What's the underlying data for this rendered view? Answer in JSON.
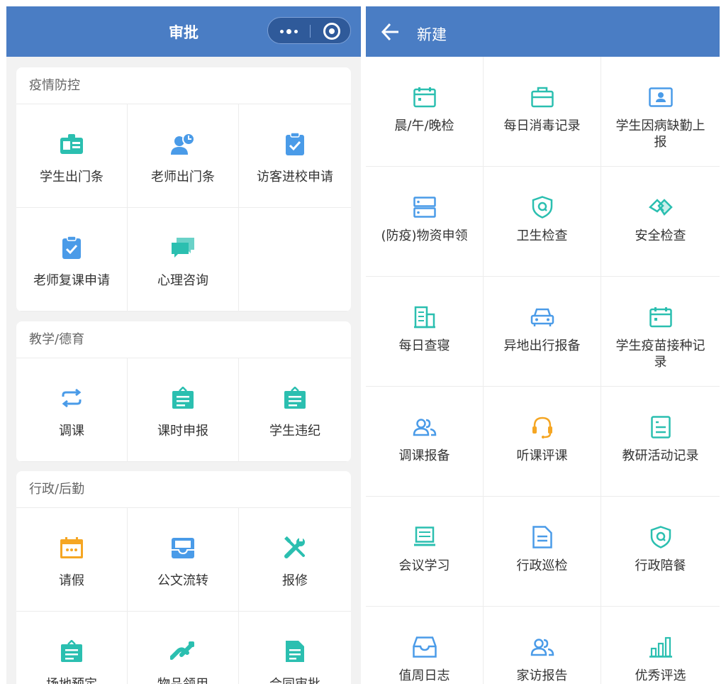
{
  "left": {
    "title": "审批",
    "sections": [
      {
        "title": "疫情防控",
        "items": [
          {
            "label": "学生出门条",
            "icon": "id-card-icon"
          },
          {
            "label": "老师出门条",
            "icon": "user-clock-icon"
          },
          {
            "label": "访客进校申请",
            "icon": "clipboard-check-icon"
          },
          {
            "label": "老师复课申请",
            "icon": "clipboard-check-icon"
          },
          {
            "label": "心理咨询",
            "icon": "chat-bubbles-icon"
          }
        ]
      },
      {
        "title": "教学/德育",
        "items": [
          {
            "label": "调课",
            "icon": "swap-icon"
          },
          {
            "label": "课时申报",
            "icon": "notice-board-icon"
          },
          {
            "label": "学生违纪",
            "icon": "notice-board-icon"
          }
        ]
      },
      {
        "title": "行政/后勤",
        "items": [
          {
            "label": "请假",
            "icon": "calendar-icon"
          },
          {
            "label": "公文流转",
            "icon": "inbox-icon"
          },
          {
            "label": "报修",
            "icon": "tools-icon"
          },
          {
            "label": "场地预定",
            "icon": "notice-board-icon"
          },
          {
            "label": "物品领用",
            "icon": "hand-icon"
          },
          {
            "label": "合同审批",
            "icon": "document-icon"
          }
        ]
      }
    ]
  },
  "right": {
    "title": "新建",
    "items": [
      {
        "label": "晨/午/晚检",
        "icon": "calendar-outline-icon"
      },
      {
        "label": "每日消毒记录",
        "icon": "briefcase-icon"
      },
      {
        "label": "学生因病缺勤上报",
        "icon": "portrait-icon"
      },
      {
        "label": "(防疫)物资申领",
        "icon": "server-icon"
      },
      {
        "label": "卫生检查",
        "icon": "shield-icon"
      },
      {
        "label": "安全检查",
        "icon": "handshake-icon"
      },
      {
        "label": "每日查寝",
        "icon": "building-icon"
      },
      {
        "label": "异地出行报备",
        "icon": "car-icon"
      },
      {
        "label": "学生疫苗接种记录",
        "icon": "calendar-outline-icon"
      },
      {
        "label": "调课报备",
        "icon": "users-icon"
      },
      {
        "label": "听课评课",
        "icon": "headset-icon"
      },
      {
        "label": "教研活动记录",
        "icon": "list-document-icon"
      },
      {
        "label": "会议学习",
        "icon": "monitor-icon"
      },
      {
        "label": "行政巡检",
        "icon": "file-icon"
      },
      {
        "label": "行政陪餐",
        "icon": "shield-icon"
      },
      {
        "label": "值周日志",
        "icon": "tray-icon"
      },
      {
        "label": "家访报告",
        "icon": "users-icon"
      },
      {
        "label": "优秀评选",
        "icon": "bar-chart-icon"
      }
    ]
  },
  "colors": {
    "header": "#4a7dc4",
    "teal": "#2bbfb0",
    "blue": "#4a9be8",
    "orange": "#f5a623"
  }
}
